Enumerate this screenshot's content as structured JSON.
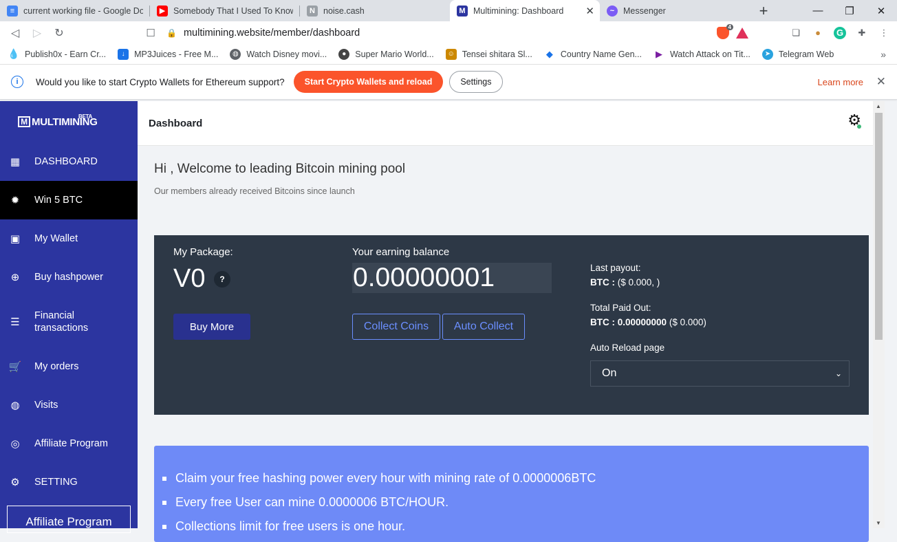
{
  "tabs": [
    {
      "title": "current working file - Google Doc",
      "icon": "google-docs-icon",
      "color": "#4285f4"
    },
    {
      "title": "Somebody That I Used To Know -",
      "icon": "youtube-icon",
      "color": "#ff0000"
    },
    {
      "title": "noise.cash",
      "icon": "noise-cash-icon",
      "color": "#9aa0a6"
    },
    {
      "title": "Multimining: Dashboard",
      "icon": "multimining-icon",
      "color": "#2c35a0",
      "active": true
    },
    {
      "title": "Messenger",
      "icon": "messenger-icon",
      "color": "#7b5cf5"
    }
  ],
  "address": {
    "url": "multimining.website/member/dashboard",
    "brave_badge": "4"
  },
  "bookmarks": [
    {
      "label": "Publish0x - Earn Cr...",
      "icon": "publish0x-icon",
      "color": "#333333"
    },
    {
      "label": "MP3Juices - Free M...",
      "icon": "mp3juices-icon",
      "color": "#1a73e8"
    },
    {
      "label": "Watch Disney movi...",
      "icon": "globe-icon",
      "color": "#5f6368"
    },
    {
      "label": "Super Mario World...",
      "icon": "mario-icon",
      "color": "#444444"
    },
    {
      "label": "Tensei shitara Sl...",
      "icon": "anime-icon",
      "color": "#cc8800"
    },
    {
      "label": "Country Name Gen...",
      "icon": "country-gen-icon",
      "color": "#1a73e8"
    },
    {
      "label": "Watch Attack on Tit...",
      "icon": "play-icon",
      "color": "#7b1fa2"
    },
    {
      "label": "Telegram Web",
      "icon": "telegram-icon",
      "color": "#2aa3df"
    }
  ],
  "infobar": {
    "message": "Would you like to start Crypto Wallets for Ethereum support?",
    "primary_label": "Start Crypto Wallets and reload",
    "settings_label": "Settings",
    "learn_more": "Learn more"
  },
  "sidebar": {
    "logo": "MULTIMINING",
    "beta": "BETA",
    "items": [
      {
        "label": "DASHBOARD",
        "icon": "dashboard-icon"
      },
      {
        "label": "Win 5 BTC",
        "icon": "badge-alert-icon",
        "active": true
      },
      {
        "label": "My Wallet",
        "icon": "wallet-icon"
      },
      {
        "label": "Buy hashpower",
        "icon": "plus-circle-icon"
      },
      {
        "label": "Financial transactions",
        "icon": "receipt-icon"
      },
      {
        "label": "My orders",
        "icon": "cart-icon"
      },
      {
        "label": "Visits",
        "icon": "globe-icon"
      },
      {
        "label": "Affiliate Program",
        "icon": "broadcast-icon"
      },
      {
        "label": "SETTING",
        "icon": "gear-icon"
      }
    ],
    "affiliate_box": "Affiliate Program"
  },
  "header": {
    "title": "Dashboard"
  },
  "main": {
    "welcome": "Hi , Welcome to leading Bitcoin mining pool",
    "subtitle": "Our members already received Bitcoins since launch",
    "package_label": "My Package:",
    "package_value": "V0",
    "help": "?",
    "buy_more": "Buy More",
    "earning_label": "Your earning balance",
    "earning_value": "0.00000001",
    "collect_coins": "Collect Coins",
    "auto_collect": "Auto Collect",
    "last_payout_label": "Last payout:",
    "last_payout_btc": "BTC :",
    "last_payout_value": "($ 0.000, )",
    "total_paid_label": "Total Paid Out:",
    "total_paid_btc": "BTC : 0.00000000",
    "total_paid_usd": "($ 0.000)",
    "auto_reload_label": "Auto Reload page",
    "auto_reload_value": "On"
  },
  "notice": [
    "Claim your free hashing power every hour with mining rate of 0.0000006BTC",
    "Every free User can mine 0.0000006 BTC/HOUR.",
    "Collections limit for free users is one hour."
  ],
  "colors": {
    "sidebar": "#2c35a0",
    "panel": "#2d3846",
    "notice": "#6e8af7",
    "brave_orange": "#fb542b"
  }
}
